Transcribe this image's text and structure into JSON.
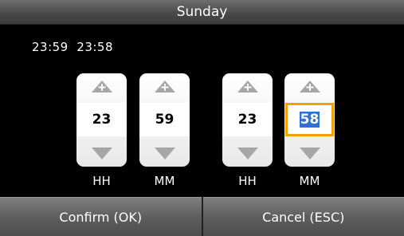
{
  "window": {
    "title": "Sunday"
  },
  "time_range": {
    "start": "23:59",
    "end": "23:58"
  },
  "spinners": [
    {
      "unit": "HH",
      "value": "23",
      "selected": false
    },
    {
      "unit": "MM",
      "value": "59",
      "selected": false
    },
    {
      "unit": "HH",
      "value": "23",
      "selected": false
    },
    {
      "unit": "MM",
      "value": "58",
      "selected": true
    }
  ],
  "icons": {
    "up": "plus-arrow-up-icon",
    "down": "arrow-down-icon"
  },
  "footer": {
    "confirm_label": "Confirm (OK)",
    "cancel_label": "Cancel (ESC)"
  },
  "colors": {
    "selection_border": "#f5a000",
    "selection_highlight": "#2f6fd8"
  }
}
